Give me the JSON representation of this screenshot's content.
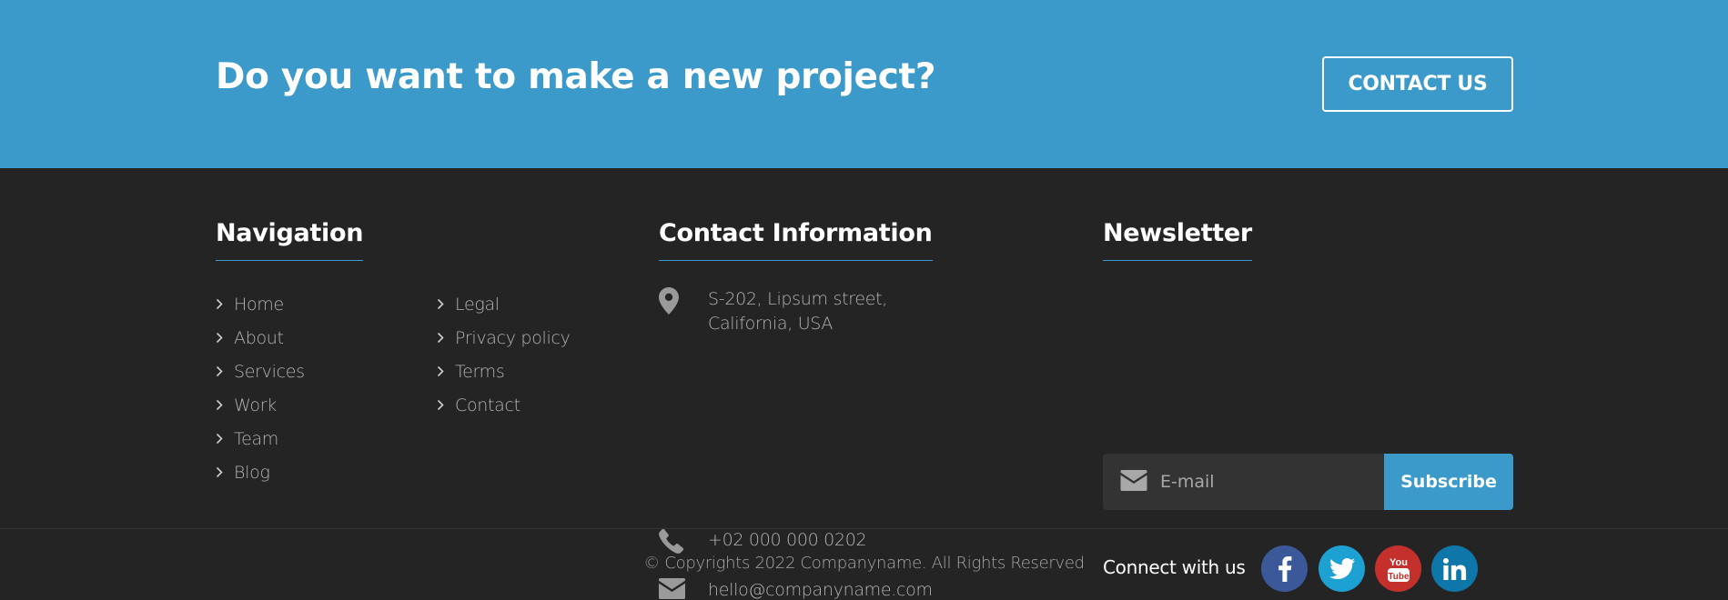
{
  "cta": {
    "title": "Do you want to make a new project?",
    "button_label": "CONTACT US"
  },
  "navigation": {
    "title": "Navigation",
    "col1": [
      "Home",
      "About",
      "Services",
      "Work",
      "Team",
      "Blog"
    ],
    "col2": [
      "Legal",
      "Privacy policy",
      "Terms",
      "Contact"
    ]
  },
  "contact": {
    "title": "Contact Information",
    "address_line1": "S-202, Lipsum street,",
    "address_line2": "California, USA",
    "phone": "+02 000 000 0202",
    "email": "hello@companyname.com"
  },
  "newsletter": {
    "title": "Newsletter",
    "placeholder": "E-mail",
    "subscribe_label": "Subscribe",
    "connect_label": "Connect with us",
    "social": [
      {
        "name": "facebook-icon",
        "glyph": "f",
        "color": "#3b5998"
      },
      {
        "name": "twitter-icon",
        "glyph": "",
        "color": "#1da1d2"
      },
      {
        "name": "youtube-icon",
        "glyph": "You\nTube",
        "color": "#c4302b"
      },
      {
        "name": "linkedin-icon",
        "glyph": "in",
        "color": "#0e76a8"
      }
    ]
  },
  "footer": {
    "copyright": "© Copyrights 2022 Companyname. All Rights Reserved"
  },
  "colors": {
    "accent": "#3b9ac9",
    "background": "#242424",
    "input_bg": "#333333"
  }
}
